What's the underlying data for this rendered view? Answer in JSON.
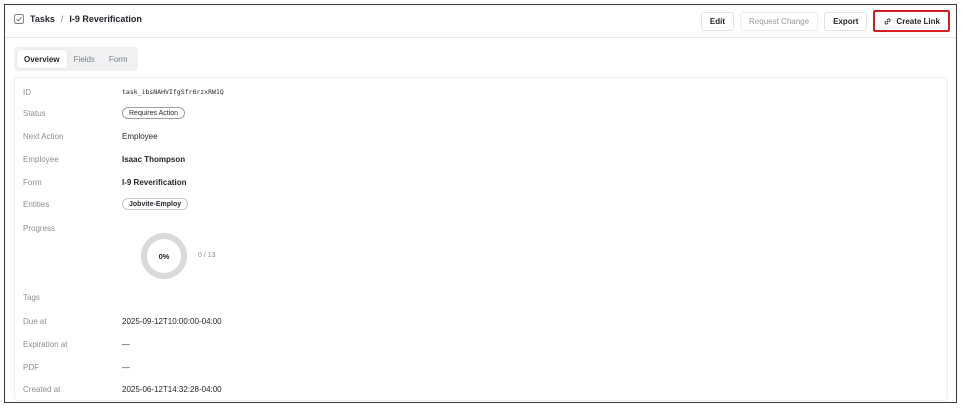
{
  "breadcrumb": {
    "root": "Tasks",
    "separator": "/",
    "current": "I-9 Reverification"
  },
  "toolbar": {
    "edit": "Edit",
    "request_change": "Request Change",
    "export": "Export",
    "create_link": "Create Link"
  },
  "tabs": [
    {
      "label": "Overview",
      "active": true
    },
    {
      "label": "Fields",
      "active": false
    },
    {
      "label": "Form",
      "active": false
    }
  ],
  "details": {
    "id": {
      "label": "ID",
      "value": "task_ibsNAHVIfgSfr6rzxRW1Q"
    },
    "status": {
      "label": "Status",
      "value": "Requires Action"
    },
    "next_action": {
      "label": "Next Action",
      "value": "Employee"
    },
    "employee": {
      "label": "Employee",
      "value": "Isaac Thompson"
    },
    "form": {
      "label": "Form",
      "value": "I-9 Reverification"
    },
    "entities": {
      "label": "Entities",
      "value": "Jobvite-Employ"
    },
    "progress": {
      "label": "Progress",
      "percent_label": "0%",
      "count": "0 / 13",
      "fraction": 0
    },
    "tags": {
      "label": "Tags",
      "value": ""
    },
    "due_at": {
      "label": "Due at",
      "value": "2025-09-12T10:00:00-04:00"
    },
    "expiration_at": {
      "label": "Expiration at",
      "value": "—"
    },
    "pdf": {
      "label": "PDF",
      "value": "—"
    },
    "created_at": {
      "label": "Created at",
      "value": "2025-06-12T14:32:28-04:00"
    }
  },
  "colors": {
    "highlight": "#d21f1f",
    "donut_track": "#d9d9d9",
    "tab_bg": "#f0f1f3"
  },
  "icons": {
    "breadcrumb": "checkbox-icon",
    "create_link": "link-icon"
  }
}
